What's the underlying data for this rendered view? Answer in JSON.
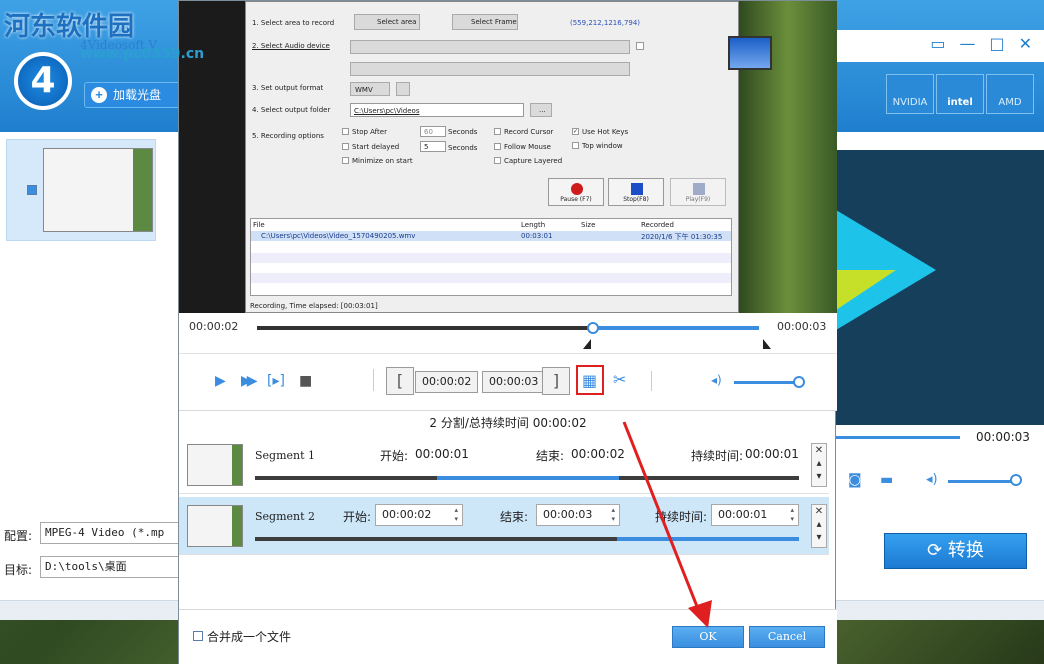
{
  "watermark": {
    "line1": "河东软件园",
    "line2": "4Videosoft V",
    "line3": "www.pc0359.cn"
  },
  "app": {
    "logo_text": "4",
    "add_disc_label": "加载光盘",
    "gpu": [
      "NVIDIA",
      "intel",
      "AMD"
    ],
    "preview_time": "00:00:03",
    "profile_label": "配置:",
    "profile_value": "MPEG-4 Video (*.mp",
    "target_label": "目标:",
    "target_value": "D:\\tools\\桌面",
    "convert_label": "转换",
    "win_icons": [
      "▭",
      "—",
      "□",
      "✕"
    ]
  },
  "shot": {
    "rows": [
      {
        "label": "1. Select area to record",
        "btn1": "Select area",
        "btn2": "Select Frame",
        "coords": "(559,212,1216,794)"
      },
      {
        "label": "2. Select Audio device"
      },
      {
        "label": "3. Set output format",
        "value": "WMV"
      },
      {
        "label": "4. Select output folder",
        "value": "C:\\Users\\pc\\Videos",
        "btn": "..."
      },
      {
        "label": "5. Recording options"
      }
    ],
    "options": [
      "Stop After",
      "Start delayed",
      "Minimize on start",
      "Record Cursor",
      "Follow Mouse",
      "Capture Layered",
      "Use Hot Keys",
      "Top window"
    ],
    "stop_after_value": "60",
    "start_delayed_value": "5",
    "seconds": "Seconds",
    "buttons": [
      "Pause (F7)",
      "Stop(F8)",
      "Play(F9)"
    ],
    "cols": [
      "File",
      "Length",
      "Size",
      "Recorded"
    ],
    "file_row": {
      "file": "C:\\Users\\pc\\Videos\\Video_1570490205.wmv",
      "length": "00:03:01",
      "recorded": "2020/1/6 下午 01:30:35"
    },
    "status": "Recording, Time elapsed: [00:03:01]"
  },
  "dialog": {
    "time_start": "00:00:02",
    "time_end": "00:00:03",
    "set_start": "00:00:02",
    "set_end": "00:00:03",
    "start_bracket": "[",
    "end_bracket": "]",
    "summary": "2 分割/总持续时间 00:00:02",
    "segments": [
      {
        "name": "Segment 1",
        "start_label": "开始:",
        "start": "00:00:01",
        "end_label": "结束:",
        "end": "00:00:02",
        "dur_label": "持续时间:",
        "dur": "00:00:01"
      },
      {
        "name": "Segment 2",
        "start_label": "开始:",
        "start": "00:00:02",
        "end_label": "结束:",
        "end": "00:00:03",
        "dur_label": "持续时间:",
        "dur": "00:00:01"
      }
    ],
    "merge_label": "合并成一个文件",
    "ok_label": "OK",
    "cancel_label": "Cancel"
  },
  "colors": {
    "accent": "#3b8de0",
    "highlight": "#e02020"
  }
}
